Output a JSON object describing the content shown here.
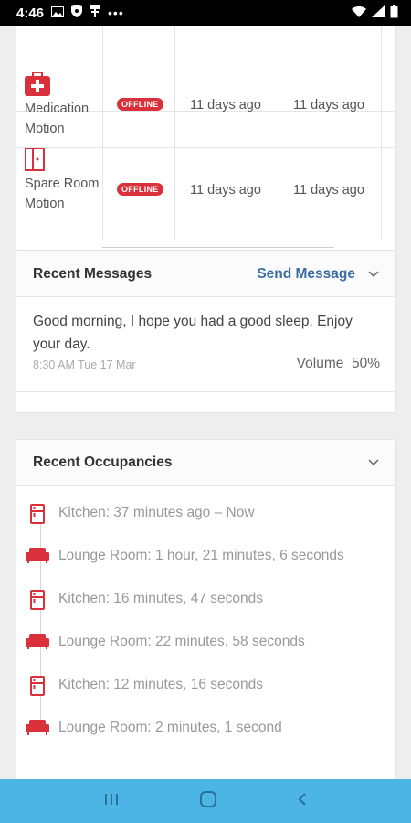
{
  "status_bar": {
    "time": "4:46",
    "icons": [
      "gallery-icon",
      "shield-icon",
      "usb-icon",
      "more-dots-icon"
    ],
    "right_icons": [
      "wifi-icon",
      "signal-icon",
      "battery-icon"
    ]
  },
  "devices": [
    {
      "name": "Medication Motion",
      "icon": "medication-kit-icon",
      "status": "OFFLINE",
      "last_seen_1": "11 days ago",
      "last_seen_2": "11 days ago"
    },
    {
      "name": "Spare Room Motion",
      "icon": "door-icon",
      "status": "OFFLINE",
      "last_seen_1": "11 days ago",
      "last_seen_2": "11 days ago"
    }
  ],
  "messages": {
    "title": "Recent Messages",
    "send_label": "Send Message",
    "text": "Good morning, I hope you had a good sleep. Enjoy your day.",
    "time": "8:30 AM Tue 17 Mar",
    "volume": "Volume  50%"
  },
  "occupancies": {
    "title": "Recent Occupancies",
    "items": [
      {
        "room": "kitchen",
        "text": "Kitchen: 37 minutes ago – Now"
      },
      {
        "room": "lounge",
        "text": "Lounge Room: 1 hour, 21 minutes, 6 seconds"
      },
      {
        "room": "kitchen",
        "text": "Kitchen: 16 minutes, 47 seconds"
      },
      {
        "room": "lounge",
        "text": "Lounge Room: 22 minutes, 58 seconds"
      },
      {
        "room": "kitchen",
        "text": "Kitchen: 12 minutes, 16 seconds"
      },
      {
        "room": "lounge",
        "text": "Lounge Room: 2 minutes, 1 second"
      }
    ]
  },
  "colors": {
    "accent_red": "#d9303b",
    "link_blue": "#3a6ea5",
    "navbar_blue": "#4db5e6"
  }
}
